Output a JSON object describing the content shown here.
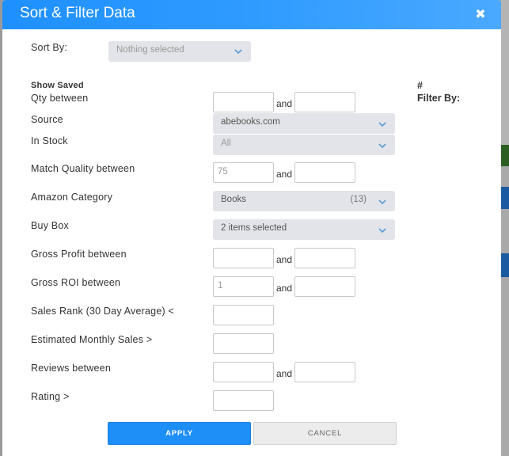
{
  "modal": {
    "title": "Sort & Filter Data",
    "close_icon": "close-icon"
  },
  "sort": {
    "label": "Sort By:",
    "placeholder": "Nothing selected"
  },
  "show_saved": "Show Saved",
  "side": {
    "hash": "#",
    "filter_by": "Filter By:"
  },
  "and_text": "and",
  "fields": {
    "qty": {
      "label": "Qty between",
      "min": "",
      "max": ""
    },
    "source": {
      "label": "Source",
      "value": "abebooks.com"
    },
    "in_stock": {
      "label": "In Stock",
      "value": "All"
    },
    "match_quality": {
      "label": "Match Quality between",
      "min": "75",
      "max": ""
    },
    "amazon_category": {
      "label": "Amazon Category",
      "value": "Books",
      "count": "(13)"
    },
    "buy_box": {
      "label": "Buy Box",
      "value": "2 items selected"
    },
    "gross_profit": {
      "label": "Gross Profit between",
      "min": "",
      "max": ""
    },
    "gross_roi": {
      "label": "Gross ROI between",
      "min": "1",
      "max": ""
    },
    "sales_rank": {
      "label": "Sales Rank (30 Day Average) <",
      "value": ""
    },
    "monthly_sales": {
      "label": "Estimated Monthly Sales >",
      "value": ""
    },
    "reviews": {
      "label": "Reviews between",
      "min": "",
      "max": ""
    },
    "rating": {
      "label": "Rating >",
      "value": ""
    }
  },
  "buttons": {
    "apply": "APPLY",
    "cancel": "CANCEL"
  },
  "colors": {
    "header": "#2f9bff",
    "apply": "#1e8ff6",
    "select_bg": "#e2e4e9"
  }
}
